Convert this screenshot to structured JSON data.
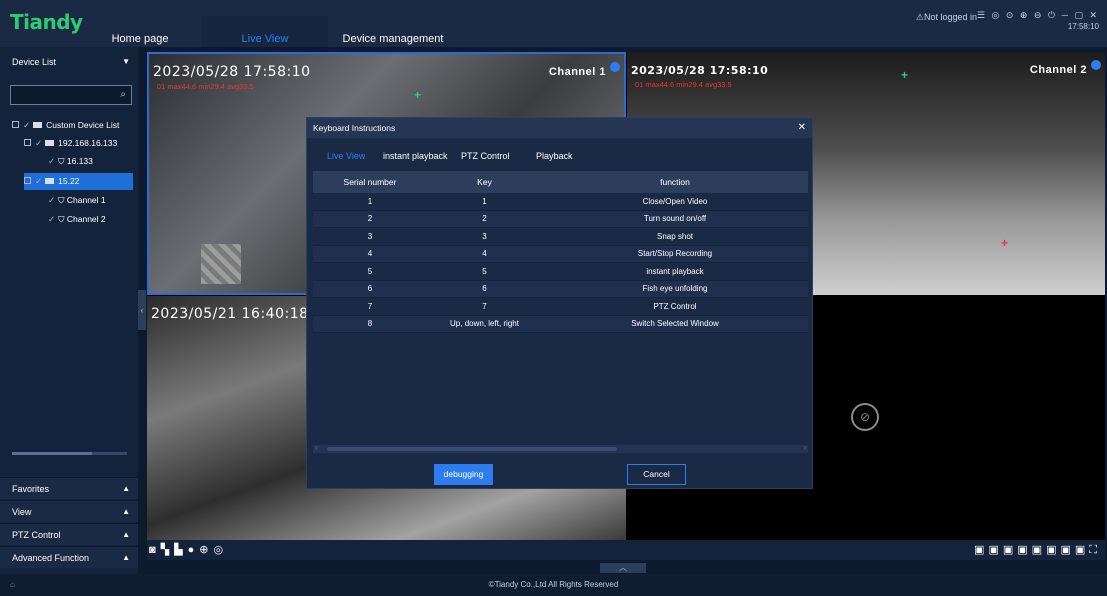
{
  "app": {
    "logo": "Tiandy",
    "nav": [
      "Home page",
      "Live View",
      "Device management"
    ],
    "status": "Not logged in",
    "window_controls": "☰ ◎ ⊙ ⊕ ⊖ ⏻ ─ ▢ ✕",
    "clock": "17:58:10"
  },
  "sidebar": {
    "header": "Device List",
    "search_placeholder": "",
    "tree": [
      {
        "label": "Custom Device List"
      },
      {
        "label": "192.168.16.133"
      },
      {
        "label": "16.133"
      },
      {
        "label": "15.22"
      },
      {
        "label": "Channel 1"
      },
      {
        "label": "Channel 2"
      }
    ],
    "sections": [
      "Favorites",
      "View",
      "PTZ Control",
      "Advanced Function"
    ]
  },
  "video": {
    "pane1": {
      "timestamp": "2023/05/28 17:58:10",
      "temp": "01 max44.6 min29.4 avg33.5",
      "channel": "Channel 1"
    },
    "pane2": {
      "timestamp": "2023/05/28 17:58:10",
      "temp": "01 max44.6 min29.4 avg33.5",
      "channel": "Channel 2"
    },
    "pane3": {
      "timestamp": "2023/05/21 16:40:18"
    }
  },
  "modal": {
    "title": "Keyboard Instructions",
    "tabs": [
      "Live View",
      "instant playback",
      "PTZ Control",
      "Playback"
    ],
    "columns": [
      "Serial number",
      "Key",
      "function"
    ],
    "rows": [
      [
        "1",
        "1",
        "Close/Open Video"
      ],
      [
        "2",
        "2",
        "Turn sound on/off"
      ],
      [
        "3",
        "3",
        "Snap shot"
      ],
      [
        "4",
        "4",
        "Start/Stop Recording"
      ],
      [
        "5",
        "5",
        "instant playback"
      ],
      [
        "6",
        "6",
        "Fish eye unfolding"
      ],
      [
        "7",
        "7",
        "PTZ Control"
      ],
      [
        "8",
        "Up, down, left, right",
        "Switch Selected Window"
      ]
    ],
    "debug_button": "debugging",
    "cancel_button": "Cancel"
  },
  "footer": {
    "copyright": "©Tiandy Co.,Ltd All Rights Reserved"
  },
  "colors": {
    "accent": "#2d7df0",
    "logo": "#2ecc71",
    "temp_text": "#e53935"
  }
}
